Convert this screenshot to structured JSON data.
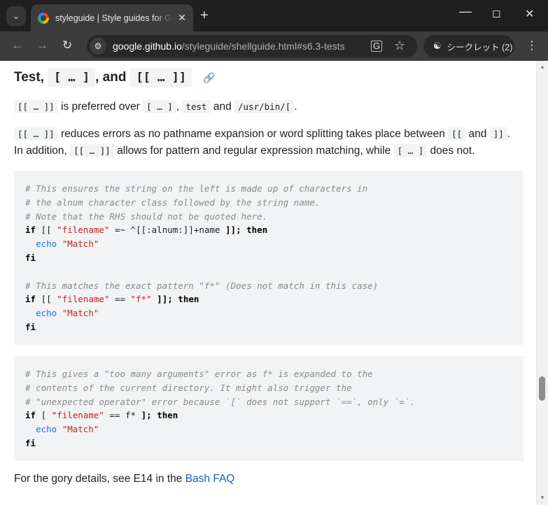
{
  "browser": {
    "tab_title": "styleguide | Style guides for Google-originated open-source projects",
    "url_host": "google.github.io",
    "url_path": "/styleguide/shellguide.html#s6.3-tests",
    "incognito_label": "シークレット (2)",
    "icons": {
      "tab_menu": "chevron-down-icon",
      "close_tab": "close-icon",
      "new_tab": "plus-icon",
      "minimize": "minimize-icon",
      "maximize": "maximize-icon",
      "close_window": "close-icon",
      "back": "arrow-left-icon",
      "forward": "arrow-right-icon",
      "reload": "reload-icon",
      "site_info": "tune-icon",
      "translate": "translate-icon",
      "bookmark": "star-icon",
      "incognito": "incognito-icon",
      "menu": "kebab-menu-icon"
    }
  },
  "content": {
    "heading": {
      "text1": "Test,",
      "code1": "[ … ]",
      "text2": ", and",
      "code2": "[[ … ]]"
    },
    "para1": {
      "code1": "[[ … ]]",
      "text1": " is preferred over ",
      "code2": "[ … ]",
      "text2": ", ",
      "code3": "test",
      "text3": " and ",
      "code4": "/usr/bin/[",
      "text4": "."
    },
    "para2": {
      "code1": "[[ … ]]",
      "text1": " reduces errors as no pathname expansion or word splitting takes place between ",
      "code2": "[[",
      "text2": " and ",
      "code3": "]]",
      "text3": ".",
      "text4": "In addition, ",
      "code4": "[[ … ]]",
      "text5": " allows for pattern and regular expression matching, while ",
      "code5": "[ … ]",
      "text6": " does not."
    },
    "code1": {
      "c1": "# This ensures the string on the left is made up of characters in",
      "c2": "# the alnum character class followed by the string name.",
      "c3": "# Note that the RHS should not be quoted here.",
      "l4_kw1": "if",
      "l4_t1": " [[ ",
      "l4_s1": "\"filename\"",
      "l4_t2": " =~ ^[[:alnum:]]+name ",
      "l4_kw2": "]];",
      "l4_t3": " ",
      "l4_kw3": "then",
      "l5_b": "echo",
      "l5_s": "\"Match\"",
      "l6_kw": "fi",
      "c8": "# This matches the exact pattern \"f*\" (Does not match in this case)",
      "l9_kw1": "if",
      "l9_t1": " [[ ",
      "l9_s1": "\"filename\"",
      "l9_t2": " == ",
      "l9_s2": "\"f*\"",
      "l9_kw2": " ]];",
      "l9_t3": " ",
      "l9_kw3": "then",
      "l10_b": "echo",
      "l10_s": "\"Match\"",
      "l11_kw": "fi"
    },
    "code2": {
      "c1": "# This gives a \"too many arguments\" error as f* is expanded to the",
      "c2": "# contents of the current directory. It might also trigger the",
      "c3": "# \"unexpected operator\" error because `[` does not support `==`, only `=`.",
      "l4_kw1": "if",
      "l4_t1": " [ ",
      "l4_s1": "\"filename\"",
      "l4_t2": " == f* ",
      "l4_kw2": "];",
      "l4_t3": " ",
      "l4_kw3": "then",
      "l5_b": "echo",
      "l5_s": "\"Match\"",
      "l6_kw": "fi"
    },
    "footer": {
      "text": "For the gory details, see E14 in the ",
      "link": "Bash FAQ"
    }
  }
}
